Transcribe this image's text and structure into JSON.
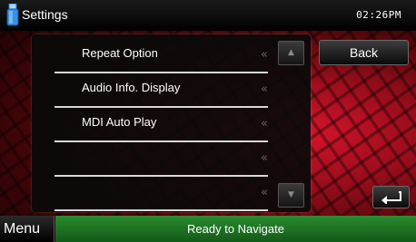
{
  "header": {
    "title": "Settings",
    "time": "02:26PM",
    "usb_icon": "usb-device-icon"
  },
  "list": {
    "items": [
      {
        "label": "Repeat Option",
        "chevron": "«"
      },
      {
        "label": "Audio Info. Display",
        "chevron": "«"
      },
      {
        "label": "MDI Auto Play",
        "chevron": "«"
      },
      {
        "label": "",
        "chevron": "«"
      },
      {
        "label": "",
        "chevron": "«"
      }
    ],
    "scroll_up_glyph": "▲",
    "scroll_down_glyph": "▼"
  },
  "buttons": {
    "back_label": "Back",
    "return_icon": "return-arrow-icon"
  },
  "footer": {
    "menu_label": "Menu",
    "status_text": "Ready to Navigate"
  },
  "colors": {
    "status_bar": "#2b8a2f",
    "background_accent": "#d8142a",
    "panel": "#0a0a0a"
  }
}
